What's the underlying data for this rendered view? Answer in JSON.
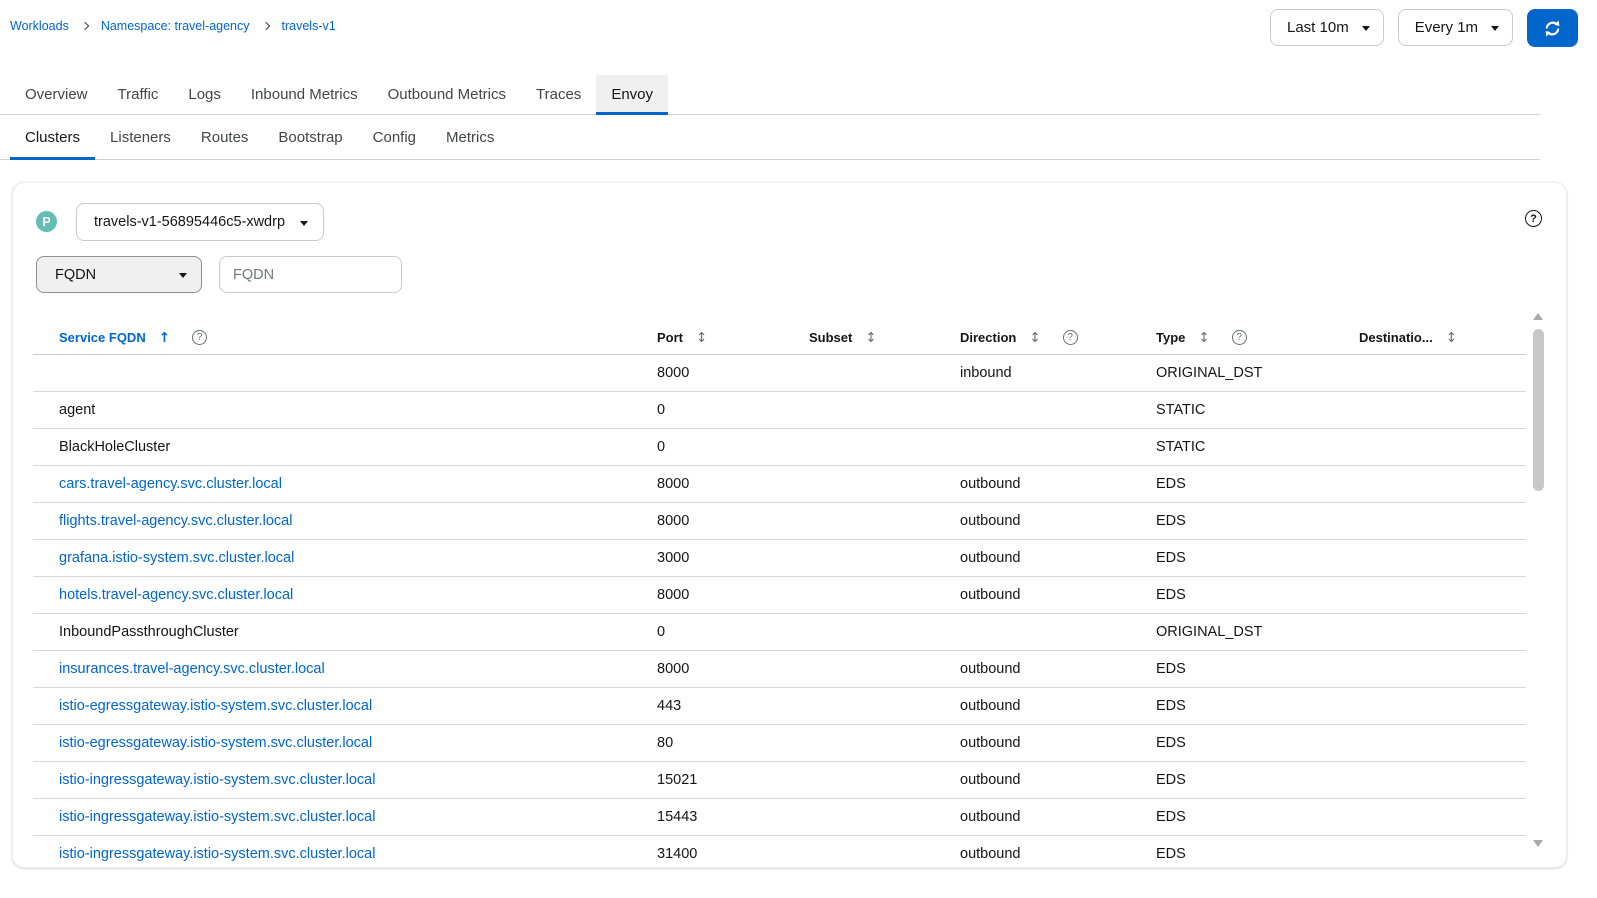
{
  "breadcrumb": {
    "items": [
      "Workloads",
      "Namespace: travel-agency",
      "travels-v1"
    ]
  },
  "toolbar": {
    "duration_label": "Last 10m",
    "interval_label": "Every 1m"
  },
  "tabs": {
    "main": [
      {
        "label": "Overview",
        "active": false
      },
      {
        "label": "Traffic",
        "active": false
      },
      {
        "label": "Logs",
        "active": false
      },
      {
        "label": "Inbound Metrics",
        "active": false
      },
      {
        "label": "Outbound Metrics",
        "active": false
      },
      {
        "label": "Traces",
        "active": false
      },
      {
        "label": "Envoy",
        "active": true
      }
    ],
    "sub": [
      {
        "label": "Clusters",
        "active": true
      },
      {
        "label": "Listeners",
        "active": false
      },
      {
        "label": "Routes",
        "active": false
      },
      {
        "label": "Bootstrap",
        "active": false
      },
      {
        "label": "Config",
        "active": false
      },
      {
        "label": "Metrics",
        "active": false
      }
    ]
  },
  "envoy_clusters": {
    "pod_badge": "P",
    "pod_selector": "travels-v1-56895446c5-xwdrp",
    "filter_type": "FQDN",
    "filter_placeholder": "FQDN",
    "table": {
      "columns": [
        {
          "label": "Service FQDN",
          "sort": "asc",
          "help": true
        },
        {
          "label": "Port",
          "sort": "none",
          "help": false
        },
        {
          "label": "Subset",
          "sort": "none",
          "help": false
        },
        {
          "label": "Direction",
          "sort": "none",
          "help": true
        },
        {
          "label": "Type",
          "sort": "none",
          "help": true
        },
        {
          "label": "Destinatio...",
          "sort": "none",
          "help": false
        }
      ],
      "rows": [
        {
          "service_fqdn": "",
          "link": false,
          "port": "8000",
          "subset": "",
          "direction": "inbound",
          "type": "ORIGINAL_DST",
          "destination_rule": ""
        },
        {
          "service_fqdn": "agent",
          "link": false,
          "port": "0",
          "subset": "",
          "direction": "",
          "type": "STATIC",
          "destination_rule": ""
        },
        {
          "service_fqdn": "BlackHoleCluster",
          "link": false,
          "port": "0",
          "subset": "",
          "direction": "",
          "type": "STATIC",
          "destination_rule": ""
        },
        {
          "service_fqdn": "cars.travel-agency.svc.cluster.local",
          "link": true,
          "port": "8000",
          "subset": "",
          "direction": "outbound",
          "type": "EDS",
          "destination_rule": ""
        },
        {
          "service_fqdn": "flights.travel-agency.svc.cluster.local",
          "link": true,
          "port": "8000",
          "subset": "",
          "direction": "outbound",
          "type": "EDS",
          "destination_rule": ""
        },
        {
          "service_fqdn": "grafana.istio-system.svc.cluster.local",
          "link": true,
          "port": "3000",
          "subset": "",
          "direction": "outbound",
          "type": "EDS",
          "destination_rule": ""
        },
        {
          "service_fqdn": "hotels.travel-agency.svc.cluster.local",
          "link": true,
          "port": "8000",
          "subset": "",
          "direction": "outbound",
          "type": "EDS",
          "destination_rule": ""
        },
        {
          "service_fqdn": "InboundPassthroughCluster",
          "link": false,
          "port": "0",
          "subset": "",
          "direction": "",
          "type": "ORIGINAL_DST",
          "destination_rule": ""
        },
        {
          "service_fqdn": "insurances.travel-agency.svc.cluster.local",
          "link": true,
          "port": "8000",
          "subset": "",
          "direction": "outbound",
          "type": "EDS",
          "destination_rule": ""
        },
        {
          "service_fqdn": "istio-egressgateway.istio-system.svc.cluster.local",
          "link": true,
          "port": "443",
          "subset": "",
          "direction": "outbound",
          "type": "EDS",
          "destination_rule": ""
        },
        {
          "service_fqdn": "istio-egressgateway.istio-system.svc.cluster.local",
          "link": true,
          "port": "80",
          "subset": "",
          "direction": "outbound",
          "type": "EDS",
          "destination_rule": ""
        },
        {
          "service_fqdn": "istio-ingressgateway.istio-system.svc.cluster.local",
          "link": true,
          "port": "15021",
          "subset": "",
          "direction": "outbound",
          "type": "EDS",
          "destination_rule": ""
        },
        {
          "service_fqdn": "istio-ingressgateway.istio-system.svc.cluster.local",
          "link": true,
          "port": "15443",
          "subset": "",
          "direction": "outbound",
          "type": "EDS",
          "destination_rule": ""
        },
        {
          "service_fqdn": "istio-ingressgateway.istio-system.svc.cluster.local",
          "link": true,
          "port": "31400",
          "subset": "",
          "direction": "outbound",
          "type": "EDS",
          "destination_rule": ""
        }
      ]
    }
  },
  "icons": {
    "sort_inactive": "↕",
    "sort_ascending": "↑",
    "help": "?",
    "refresh": "sync-icon",
    "dropdown": "caret-down-icon",
    "breadcrumb_separator": "chevron-right-icon"
  },
  "colors": {
    "accent_blue": "#0066cc",
    "link_blue": "#0066cc",
    "pod_badge_teal": "#62bdb2",
    "row_border": "#d7d7d8",
    "active_tab_bg": "#f0f0f0"
  }
}
